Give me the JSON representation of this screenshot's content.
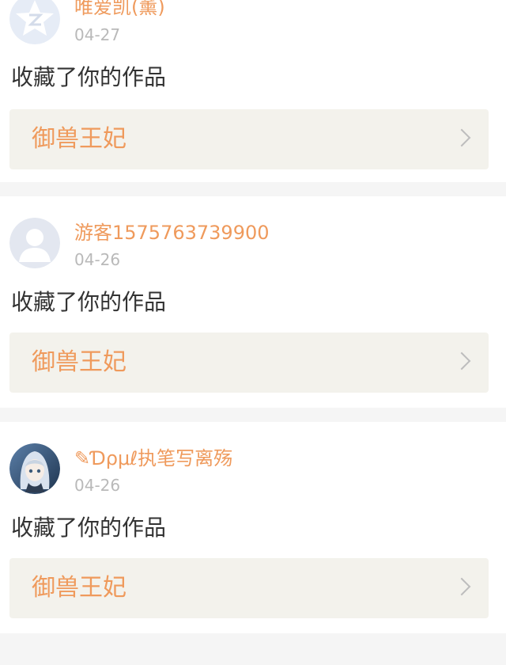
{
  "notifications": [
    {
      "user_name": "唯爱凯(薰)",
      "date": "04-27",
      "action": "收藏了你的作品",
      "work_title": "御兽王妃",
      "avatar_icon": "qzone-default-avatar-icon"
    },
    {
      "user_name": "游客1575763739900",
      "date": "04-26",
      "action": "收藏了你的作品",
      "work_title": "御兽王妃",
      "avatar_icon": "guest-default-avatar-icon"
    },
    {
      "user_name": "✎Ɗρμℓ执笔写离殇",
      "date": "04-26",
      "action": "收藏了你的作品",
      "work_title": "御兽王妃",
      "avatar_icon": "anime-girl-avatar-icon"
    }
  ],
  "colors": {
    "accent": "#ef9a5c",
    "date": "#b9b9b9",
    "action_text": "#333333",
    "work_link_bg": "#f3f2ec",
    "page_bg": "#f5f5f5"
  }
}
